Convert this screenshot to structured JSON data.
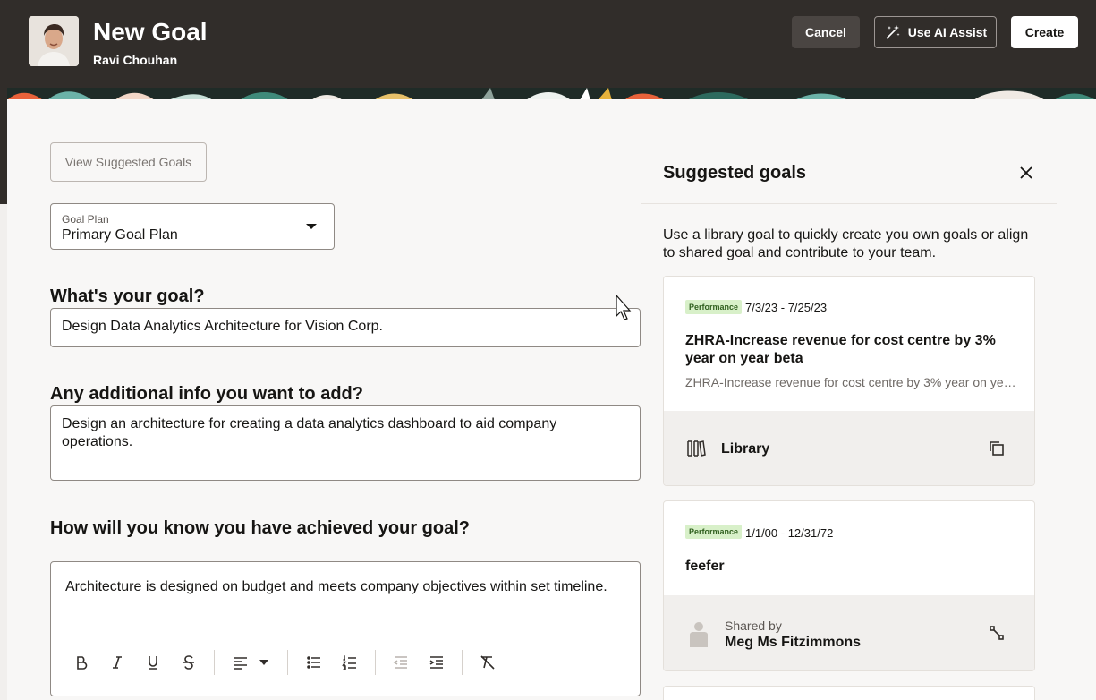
{
  "header": {
    "title": "New Goal",
    "user_name": "Ravi Chouhan",
    "cancel_label": "Cancel",
    "ai_assist_label": "Use AI Assist",
    "create_label": "Create"
  },
  "form": {
    "view_suggested_label": "View Suggested Goals",
    "goal_plan": {
      "label": "Goal Plan",
      "value": "Primary Goal Plan"
    },
    "goal_question": "What's your goal?",
    "goal_value": "Design Data Analytics Architecture for Vision Corp.",
    "info_question": "Any additional info you want to add?",
    "info_value": "Design an architecture for creating a data analytics dashboard to aid company operations.",
    "achieve_question": "How will you know you have achieved your goal?",
    "achieve_value": "Architecture is designed on budget and meets company objectives within set timeline.",
    "toolbar": [
      "bold-icon",
      "italic-icon",
      "underline-icon",
      "strikethrough-icon",
      "align-left-icon",
      "bulleted-list-icon",
      "numbered-list-icon",
      "outdent-icon",
      "indent-icon",
      "clear-format-icon"
    ]
  },
  "panel": {
    "title": "Suggested goals",
    "description": "Use a library goal to quickly create you own goals or align to shared goal and contribute to your team.",
    "goals": [
      {
        "badge": "Performance",
        "dates": "7/3/23 - 7/25/23",
        "title": "ZHRA-Increase revenue for cost centre by 3% year on year beta",
        "description": "ZHRA-Increase revenue for cost centre by 3% year on year beta",
        "source": "Library"
      },
      {
        "badge": "Performance",
        "dates": "1/1/00 - 12/31/72",
        "title": "feefer",
        "shared_by_label": "Shared by",
        "shared_by_name": "Meg Ms Fitzimmons"
      }
    ]
  },
  "colors": {
    "header_bg": "#312d2a",
    "badge_bg": "#d8f0c9",
    "badge_text": "#2f5f1e"
  }
}
